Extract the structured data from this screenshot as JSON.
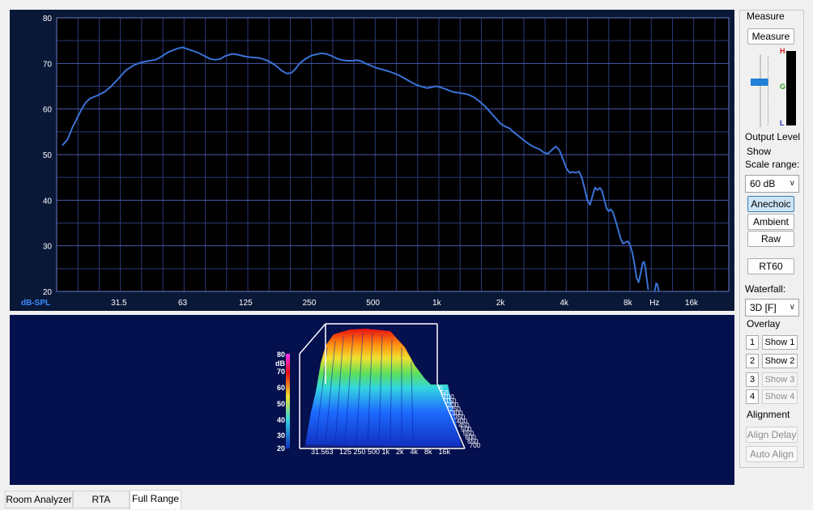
{
  "main_plot": {
    "corner_label": "dB-SPL",
    "unit_label": "Hz",
    "y_ticks": [
      "80",
      "70",
      "60",
      "50",
      "40",
      "30",
      "20"
    ],
    "x_ticks": [
      "31.5",
      "63",
      "125",
      "250",
      "500",
      "1k",
      "2k",
      "4k",
      "8k",
      "16k"
    ]
  },
  "chart_data": {
    "type": "line",
    "ylabel": "dB-SPL",
    "xlabel": "Hz",
    "ylim": [
      20,
      80
    ],
    "xlim": [
      16,
      24000
    ],
    "x_scale": "log",
    "grid": true,
    "series": [
      {
        "color": "#3a72d6",
        "points": [
          [
            17,
            52.0
          ],
          [
            18,
            53.3
          ],
          [
            19,
            56.0
          ],
          [
            20,
            58.0
          ],
          [
            21,
            60.0
          ],
          [
            22,
            61.5
          ],
          [
            23,
            62.3
          ],
          [
            25,
            63.0
          ],
          [
            27,
            63.8
          ],
          [
            29,
            65.0
          ],
          [
            31.5,
            66.8
          ],
          [
            34,
            68.5
          ],
          [
            37,
            69.6
          ],
          [
            40,
            70.2
          ],
          [
            43,
            70.5
          ],
          [
            47,
            70.8
          ],
          [
            50,
            71.5
          ],
          [
            53,
            72.3
          ],
          [
            56,
            72.8
          ],
          [
            60,
            73.3
          ],
          [
            63,
            73.5
          ],
          [
            66,
            73.2
          ],
          [
            70,
            72.8
          ],
          [
            75,
            72.3
          ],
          [
            80,
            71.6
          ],
          [
            85,
            71.0
          ],
          [
            90,
            70.8
          ],
          [
            95,
            71.0
          ],
          [
            100,
            71.6
          ],
          [
            108,
            72.1
          ],
          [
            115,
            71.9
          ],
          [
            125,
            71.5
          ],
          [
            135,
            71.3
          ],
          [
            145,
            71.2
          ],
          [
            155,
            70.8
          ],
          [
            165,
            70.2
          ],
          [
            175,
            69.4
          ],
          [
            185,
            68.4
          ],
          [
            195,
            67.8
          ],
          [
            205,
            67.9
          ],
          [
            215,
            68.8
          ],
          [
            225,
            70.0
          ],
          [
            240,
            71.0
          ],
          [
            255,
            71.7
          ],
          [
            270,
            72.0
          ],
          [
            285,
            72.2
          ],
          [
            300,
            72.1
          ],
          [
            320,
            71.6
          ],
          [
            340,
            71.0
          ],
          [
            360,
            70.7
          ],
          [
            380,
            70.6
          ],
          [
            400,
            70.6
          ],
          [
            420,
            70.7
          ],
          [
            440,
            70.5
          ],
          [
            460,
            70.0
          ],
          [
            490,
            69.5
          ],
          [
            520,
            69.0
          ],
          [
            560,
            68.6
          ],
          [
            600,
            68.2
          ],
          [
            650,
            67.6
          ],
          [
            700,
            66.8
          ],
          [
            750,
            66.0
          ],
          [
            800,
            65.3
          ],
          [
            850,
            64.9
          ],
          [
            900,
            64.6
          ],
          [
            950,
            64.8
          ],
          [
            1000,
            65.0
          ],
          [
            1050,
            64.7
          ],
          [
            1100,
            64.4
          ],
          [
            1150,
            64.0
          ],
          [
            1200,
            63.7
          ],
          [
            1300,
            63.5
          ],
          [
            1400,
            63.2
          ],
          [
            1500,
            62.6
          ],
          [
            1600,
            61.6
          ],
          [
            1700,
            60.5
          ],
          [
            1800,
            59.2
          ],
          [
            1900,
            58.0
          ],
          [
            2000,
            56.8
          ],
          [
            2100,
            56.2
          ],
          [
            2200,
            55.8
          ],
          [
            2300,
            55.0
          ],
          [
            2450,
            54.0
          ],
          [
            2600,
            53.0
          ],
          [
            2750,
            52.2
          ],
          [
            2900,
            51.6
          ],
          [
            3050,
            51.2
          ],
          [
            3200,
            50.5
          ],
          [
            3350,
            50.2
          ],
          [
            3500,
            51.0
          ],
          [
            3650,
            51.8
          ],
          [
            3800,
            51.0
          ],
          [
            3950,
            49.0
          ],
          [
            4100,
            47.0
          ],
          [
            4250,
            46.0
          ],
          [
            4400,
            46.2
          ],
          [
            4550,
            46.0
          ],
          [
            4700,
            46.3
          ],
          [
            4850,
            45.0
          ],
          [
            5000,
            42.5
          ],
          [
            5150,
            40.0
          ],
          [
            5300,
            39.0
          ],
          [
            5450,
            41.0
          ],
          [
            5600,
            42.8
          ],
          [
            5750,
            42.2
          ],
          [
            5900,
            42.7
          ],
          [
            6050,
            42.0
          ],
          [
            6200,
            40.0
          ],
          [
            6350,
            38.2
          ],
          [
            6500,
            37.6
          ],
          [
            6650,
            38.0
          ],
          [
            6800,
            37.4
          ],
          [
            7000,
            35.5
          ],
          [
            7200,
            33.5
          ],
          [
            7400,
            31.5
          ],
          [
            7600,
            30.5
          ],
          [
            7800,
            30.8
          ],
          [
            8000,
            31.0
          ],
          [
            8200,
            30.2
          ],
          [
            8400,
            28.5
          ],
          [
            8600,
            26.0
          ],
          [
            8800,
            23.0
          ],
          [
            9000,
            22.0
          ],
          [
            9200,
            24.0
          ],
          [
            9400,
            26.2
          ],
          [
            9550,
            26.5
          ],
          [
            9700,
            25.0
          ],
          [
            9850,
            22.5
          ],
          [
            10000,
            20.3
          ]
        ]
      },
      {
        "color": "#3a72d6",
        "points": [
          [
            10700,
            20.0
          ],
          [
            10900,
            21.8
          ],
          [
            11050,
            21.5
          ],
          [
            11200,
            20.0
          ]
        ]
      }
    ]
  },
  "waterfall": {
    "z_ticks": [
      "80",
      "dB",
      "70",
      "60",
      "50",
      "40",
      "30",
      "20"
    ],
    "x_ticks": [
      "31.5",
      "63",
      "125",
      "250",
      "500",
      "1k",
      "2k",
      "4k",
      "8k",
      "16k"
    ],
    "t_ticks": [
      "0",
      "50",
      "100",
      "150",
      "200",
      "250",
      "300",
      "350",
      "400",
      "450",
      "500",
      "550",
      "600",
      "650",
      "700"
    ]
  },
  "sidebar": {
    "measure_title": "Measure",
    "measure_button": "Measure",
    "meter_high": "H",
    "meter_good": "G",
    "meter_low": "L",
    "output_level": "Output Level",
    "output_level_value": 0.62,
    "show_title": "Show",
    "scale_range_label": "Scale range:",
    "scale_range_value": "60 dB",
    "anechoic": "Anechoic",
    "ambient": "Ambient",
    "raw": "Raw",
    "rt60": "RT60",
    "waterfall_label": "Waterfall:",
    "waterfall_value": "3D [F]",
    "overlay_title": "Overlay",
    "overlays": [
      {
        "num": "1",
        "label": "Show 1"
      },
      {
        "num": "2",
        "label": "Show 2"
      },
      {
        "num": "3",
        "label": "Show 3"
      },
      {
        "num": "4",
        "label": "Show 4"
      }
    ],
    "alignment_title": "Alignment",
    "align_delay": "Align Delay",
    "auto_align": "Auto Align"
  },
  "tabs": [
    "Room Analyzer",
    "RTA",
    "Full Range"
  ],
  "colors": {
    "plot_bg": "#0a1838",
    "curve": "#3a72d6",
    "waterfall_bg": "#05104e",
    "accent": "#3c7fb1"
  }
}
